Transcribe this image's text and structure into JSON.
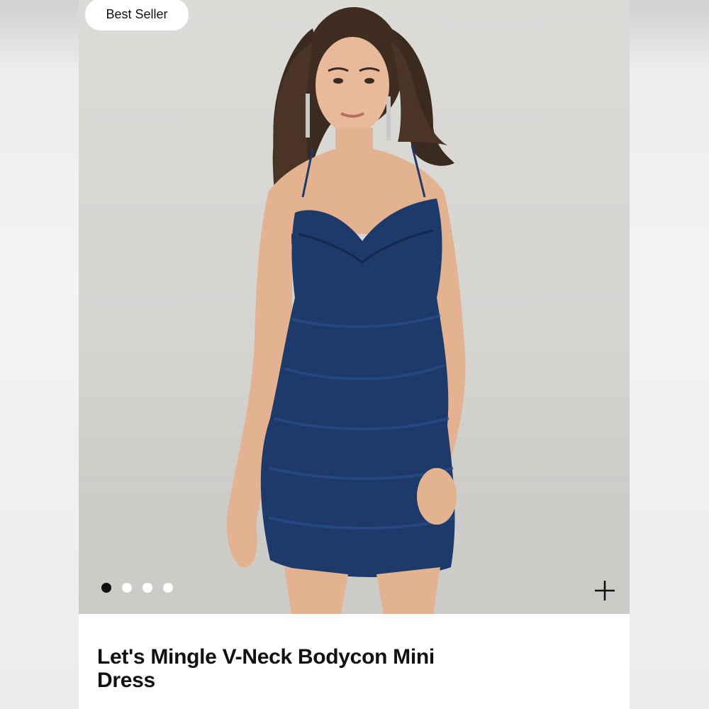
{
  "product": {
    "badge": "Best Seller",
    "title": "Let's Mingle V-Neck Bodycon Mini Dress",
    "image_alt": "model wearing navy satin bodycon mini dress"
  },
  "carousel": {
    "dot_count": 4,
    "active_index": 0
  },
  "icons": {
    "add": "plus-icon"
  },
  "colors": {
    "dress": "#1d3a6b",
    "badge_bg": "#ffffff",
    "dot_active": "#111111",
    "dot_inactive": "#ffffff"
  }
}
